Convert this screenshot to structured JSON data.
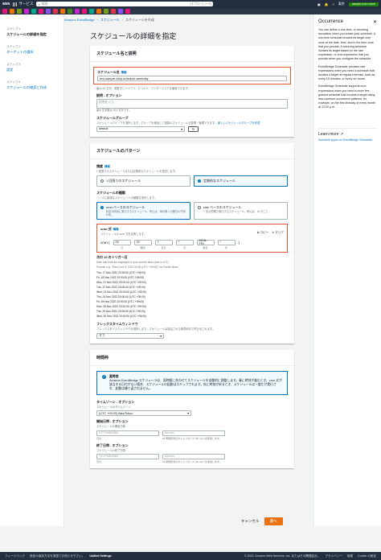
{
  "topbar": {
    "logo": "aws",
    "services_label": "サービス",
    "search_placeholder": "検索",
    "search_shortcut": "[オプション+S]",
    "region": "東京",
    "account": "sample-user-name"
  },
  "colors": {
    "topbar": "#232f3e",
    "highlight": "#e0573a",
    "primary": "#ec7211",
    "link": "#0073bb"
  },
  "breadcrumb": [
    "Amazon EventBridge",
    "スケジュール",
    "スケジュールを作成"
  ],
  "steps": [
    {
      "num": "ステップ 1",
      "title": "スケジュールの詳細を指定"
    },
    {
      "num": "ステップ 2",
      "title": "ターゲットの選択"
    },
    {
      "num": "ステップ 3",
      "title": "設定"
    },
    {
      "num": "ステップ 4",
      "title": "スケジュールの確認と作成"
    }
  ],
  "page_title": "スケジュールの詳細を指定",
  "name_section": {
    "header": "スケジュール名と説明",
    "name_label": "スケジュール名",
    "name_info": "情報",
    "name_value": "ecs-sample-stop-schedule-weekday",
    "name_hint": "最大 64 文字。英数字とハイフン、ピリオド、アンダースコアを使用できます。",
    "desc_label": "説明 - オプション",
    "desc_placeholder": "説明を入力",
    "desc_hint": "最大文字数は 512 文字です。",
    "group_label": "スケジュールグループ",
    "group_hint": "スケジュールグループを選択します。グループを使用して複数のスケジュールを整理・管理できます。",
    "group_link": "新しいスケジュールグループを作成",
    "group_value": "default"
  },
  "pattern_section": {
    "header": "スケジュールのパターン",
    "freq_label": "頻度",
    "freq_info": "情報",
    "freq_hint": "1 回限りのスケジュールまたは定期的なスケジュールを選択します。",
    "freq_options": [
      "1 回限りのスケジュール",
      "定期的なスケジュール"
    ],
    "type_label": "スケジュールの種類",
    "type_hint": "ニーズに最適なスケジュールの種類を選択します。",
    "type_options": [
      {
        "title": "cron ベースのスケジュール",
        "desc": "特定の時刻に実行するスケジュール。例えば、毎月第 1 月曜日の午前 8 時。"
      },
      {
        "title": "rate ベースのスケジュール",
        "desc": "一定の間隔で実行するスケジュール。例えば、10 分ごと。"
      }
    ],
    "cron_label": "cron 式",
    "cron_info": "情報",
    "cron_hint": "スケジュールの cron 式を定義します。",
    "copy_label": "コピー",
    "clear_label": "クリア",
    "cron_prefix": "cron (",
    "cron_suffix": ")",
    "cron_fields": [
      {
        "value": "00",
        "caption": "分"
      },
      {
        "value": "20",
        "caption": "時間"
      },
      {
        "value": "?",
        "caption": "日付"
      },
      {
        "value": "*",
        "caption": "月"
      },
      {
        "value": "MON-FRI",
        "caption": "曜日"
      },
      {
        "value": "*",
        "caption": "年"
      }
    ],
    "next_label": "次の 10 のトリガー日",
    "next_hint1": "Date and time are displayed in your current time zone in UTC.",
    "next_hint2": "Format: e.g. \"Wed, Nov 9, 2022 00:00 (UTC +09:00)\" for Pacific times",
    "next_dates": [
      "Thu, 17 Nov 2022 20:00:00 (UTC +09:00)",
      "Fri, 18 Nov 2022 20:00:00 (UTC +09:00)",
      "Mon, 21 Nov 2022 20:00:00 (UTC +09:00)",
      "Tue, 22 Nov 2022 20:00:00 (UTC +09:00)",
      "Wed, 23 Nov 2022 20:00:00 (UTC +09:00)",
      "Thu, 24 Nov 2022 20:00:00 (UTC +09:00)",
      "Fri, 25 Nov 2022 20:00:00 (UTC +09:00)",
      "Mon, 28 Nov 2022 20:00:00 (UTC +09:00)",
      "Tue, 29 Nov 2022 20:00:00 (UTC +09:00)",
      "Wed, 30 Nov 2022 20:00:00 (UTC +09:00)"
    ],
    "flex_label": "フレックスタイムウィンドウ",
    "flex_hint": "フレックスタイムウィンドウを選択します。スケジュールは指定された時間枠内で呼び出されます。",
    "flex_value": "オフ"
  },
  "time_section": {
    "header": "時間枠",
    "alert_title": "夏時間",
    "alert_text": "Amazon EventBridge スケジューラは、夏時間に合わせてスケジュールを自動的に調整します。春に時刻が進むとき、cron 式が該当する日付がない場合、スケジュールの起動はスキップされます。秋に時刻が戻るとき、スケジュールは一度だけ実行され、起動は繰り返されません。",
    "tz_label": "タイムゾーン - オプション",
    "tz_hint": "スケジュールのタイムゾーン",
    "tz_value": "(UTC +09:00) Asia/Tokyo",
    "start_label": "開始日時 - オプション",
    "start_hint": "スケジュールの開始日時",
    "end_label": "終了日時 - オプション",
    "end_hint": "スケジュールの終了日時",
    "date_placeholder": "YYYY/MM/DD",
    "time_placeholder": "hh:mm",
    "date_caption": "日付",
    "time_caption": "24 時間形式のタイムスタンプ (hh:mm) を使用します。"
  },
  "actions": {
    "cancel": "キャンセル",
    "next": "次へ"
  },
  "help": {
    "title": "Occurrence",
    "p1": "You can define a one-time, or recurring invocation when you create your schedule. A one-time schedule invokes its target only once at the date, time, and in the time zone that you provide. A recurring schedule invokes its target based on the rate expression, or cron expression that you provide when you configure the schedule.",
    "p2": "EventBridge Scheduler provides rate expressions when you need a schedule that invokes a target at regular intervals, such as every 15 minutes, or every six hours.",
    "p3": "EventBridge Scheduler supports cron expressions when you need a more fine-grained schedule that invokes a target using less common occurrence patterns, for example, on the first Monday of every month at 12:00 p.m.",
    "learn_more": "Learn more",
    "link": "Schedule types on EventBridge Scheduler"
  },
  "footer": {
    "feedback": "フィードバック",
    "notice": "設定の保存方法を英語でお知らせ下さい。",
    "unified": "Unified Settings",
    "copyright": "© 2022, Amazon Web Services, Inc. またはその関連会社。",
    "privacy": "プライバシー",
    "terms": "用語",
    "cookie": "Cookie の設定"
  }
}
